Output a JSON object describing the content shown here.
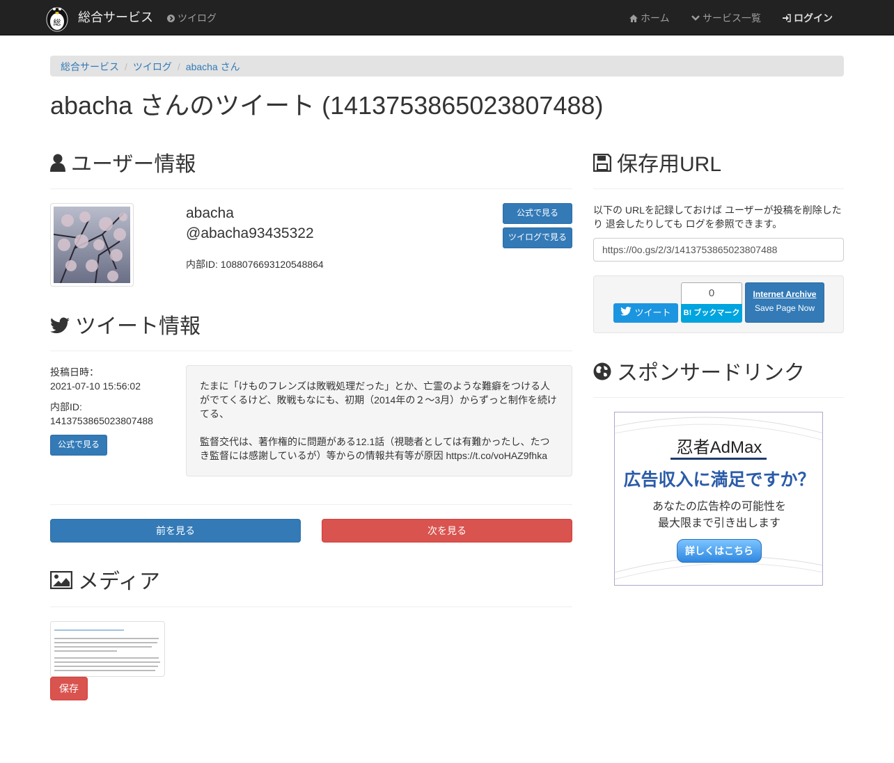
{
  "navbar": {
    "brand": "総合サービス",
    "left_link": "ツイログ",
    "right_links": [
      {
        "label": "ホーム",
        "icon": "home-icon"
      },
      {
        "label": "サービス一覧",
        "icon": "chevron-down-icon"
      },
      {
        "label": "ログイン",
        "icon": "sign-in-icon"
      }
    ]
  },
  "breadcrumb": [
    "総合サービス",
    "ツイログ",
    "abacha さん"
  ],
  "page_title": "abacha さんのツイート (1413753865023807488)",
  "user_section": {
    "heading": "ユーザー情報",
    "name": "abacha",
    "handle": "@abacha93435322",
    "internal_id": "内部ID: 1088076693120548864",
    "btn_official": "公式で見る",
    "btn_twilog": "ツイログで見る"
  },
  "tweet_section": {
    "heading": "ツイート情報",
    "posted_label": "投稿日時：",
    "posted_value": "2021-07-10 15:56:02",
    "id_label": "内部ID:",
    "id_value": "1413753865023807488",
    "btn_official": "公式で見る",
    "text_p1": "たまに「けものフレンズは敗戦処理だった」とか、亡霊のような難癖をつける人がでてくるけど、敗戦もなにも、初期（2014年の２～3月）からずっと制作を続けてる、",
    "text_p2": "監督交代は、著作権的に問題がある12.1話（視聴者としては有難かったし、たつき監督には感謝しているが）等からの情報共有等が原因 https://t.co/voHAZ9fhka"
  },
  "pager": {
    "prev": "前を見る",
    "next": "次を見る"
  },
  "media_section": {
    "heading": "メディア",
    "save": "保存"
  },
  "save_url_section": {
    "heading": "保存用URL",
    "description": "以下の URLを記録しておけば ユーザーが投稿を削除したり 退会したりしても ログを参照できます。",
    "url": "https://0o.gs/2/3/1413753865023807488",
    "tweet_btn": "ツイート",
    "hatena_count": "0",
    "hatena_btn": "B! ブックマーク",
    "ia_title": "Internet Archive",
    "ia_sub": "Save Page Now"
  },
  "sponsor_section": {
    "heading": "スポンサードリンク",
    "ad_logo": "忍者AdMax",
    "ad_head": "広告収入に満足ですか？",
    "ad_sub1": "あなたの広告枠の可能性を",
    "ad_sub2": "最大限まで引き出します",
    "ad_cta": "詳しくはこちら"
  },
  "colors": {
    "primary": "#337ab7",
    "danger": "#d9534f",
    "navbar": "#222222",
    "twitter": "#1b95e0",
    "hatena": "#00a4de"
  }
}
